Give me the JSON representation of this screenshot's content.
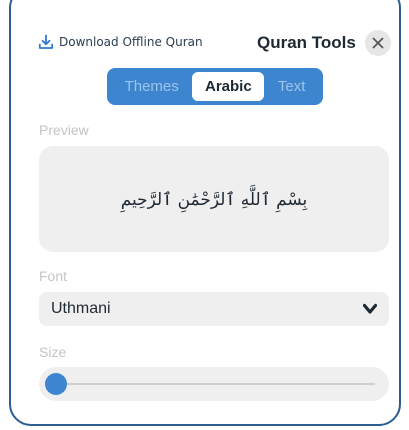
{
  "header": {
    "download_label": "Download Offline Quran",
    "title": "Quran Tools"
  },
  "tabs": [
    {
      "label": "Themes",
      "active": false
    },
    {
      "label": "Arabic",
      "active": true
    },
    {
      "label": "Text",
      "active": false
    }
  ],
  "preview": {
    "label": "Preview",
    "text": "بِسْمِ ٱللَّهِ ٱلرَّحْمَٰنِ ٱلرَّحِيمِ"
  },
  "font": {
    "label": "Font",
    "selected": "Uthmani"
  },
  "size": {
    "label": "Size",
    "value_fraction": 0.0
  },
  "colors": {
    "accent": "#3d86cf",
    "border": "#2c5d93"
  },
  "icons": {
    "download": "download-icon",
    "close": "close-icon",
    "dropdown": "chevron-down-icon"
  }
}
